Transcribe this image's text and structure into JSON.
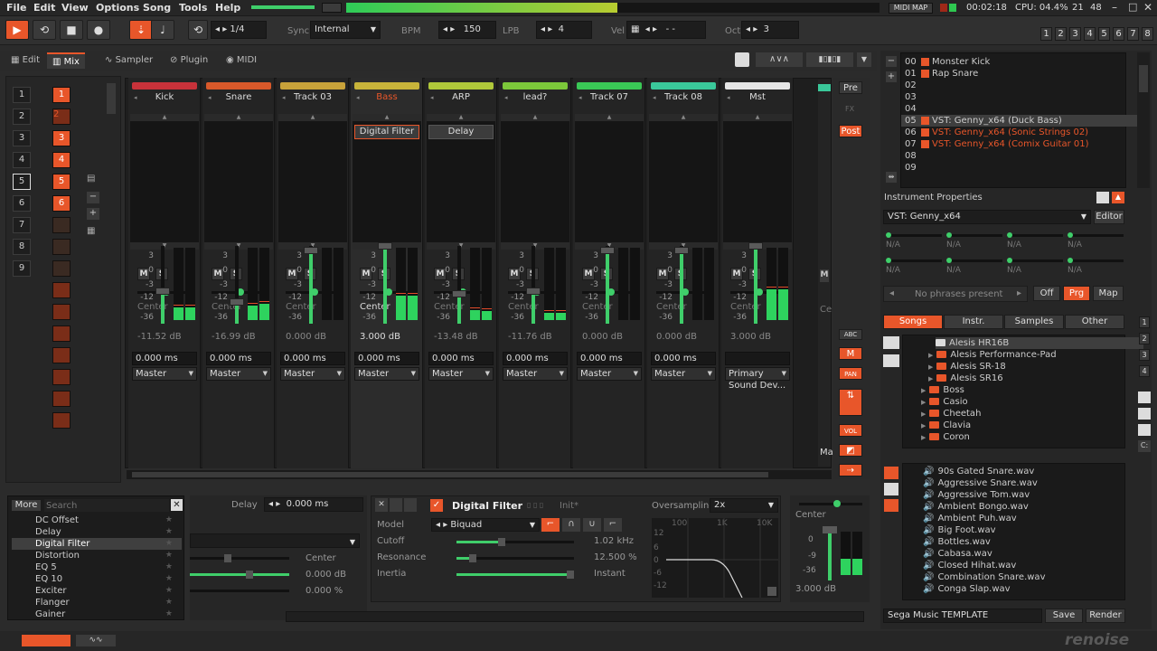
{
  "menu": [
    "File",
    "Edit",
    "View",
    "Options",
    "Song",
    "Tools",
    "Help"
  ],
  "topbar": {
    "midi_map": "MIDI MAP",
    "time": "00:02:18",
    "cpu": "CPU: 04.4%",
    "n1": "21",
    "n2": "48"
  },
  "toolbar": {
    "pattern_step": "1/4",
    "sync_label": "Sync",
    "sync_value": "Internal",
    "bpm_label": "BPM",
    "bpm_value": "150",
    "lpb_label": "LPB",
    "lpb_value": "4",
    "vel_label": "Vel",
    "vel_value": "- -",
    "oct_label": "Oct",
    "oct_value": "3",
    "track_nums": [
      "1",
      "2",
      "3",
      "4",
      "5",
      "6",
      "7",
      "8"
    ]
  },
  "tabs": [
    {
      "label": "Edit"
    },
    {
      "label": "Mix"
    },
    {
      "label": "Sampler"
    },
    {
      "label": "Plugin"
    },
    {
      "label": "MIDI"
    }
  ],
  "sequencer": {
    "rows": [
      "1",
      "2",
      "3",
      "4",
      "5",
      "6",
      "7",
      "8",
      "9"
    ],
    "slots": [
      "1",
      "2",
      "3",
      "4",
      "5",
      "6"
    ]
  },
  "tracks": [
    {
      "name": "Kick",
      "color": "#c8323a",
      "db": "-11.52 dB",
      "fx": [],
      "delay": "0.000 ms",
      "route": "Master",
      "center": "Center"
    },
    {
      "name": "Snare",
      "color": "#d9592a",
      "db": "-16.99 dB",
      "fx": [],
      "delay": "0.000 ms",
      "route": "Master",
      "center": "Center"
    },
    {
      "name": "Track 03",
      "color": "#c8a23a",
      "db": "0.000 dB",
      "fx": [],
      "delay": "0.000 ms",
      "route": "Master",
      "center": "Center"
    },
    {
      "name": "Bass",
      "color": "#c8b43a",
      "db": "3.000 dB",
      "fx": [
        "Digital Filter"
      ],
      "delay": "0.000 ms",
      "route": "Master",
      "center": "Center"
    },
    {
      "name": "ARP",
      "color": "#b0c83a",
      "db": "-13.48 dB",
      "fx": [
        "Delay"
      ],
      "delay": "0.000 ms",
      "route": "Master",
      "center": "Center"
    },
    {
      "name": "lead?",
      "color": "#7cc83a",
      "db": "-11.76 dB",
      "fx": [],
      "delay": "0.000 ms",
      "route": "Master",
      "center": "Center"
    },
    {
      "name": "Track 07",
      "color": "#3ac856",
      "db": "0.000 dB",
      "fx": [],
      "delay": "0.000 ms",
      "route": "Master",
      "center": "Center"
    },
    {
      "name": "Track 08",
      "color": "#3ac89a",
      "db": "0.000 dB",
      "fx": [],
      "delay": "0.000 ms",
      "route": "Master",
      "center": "Center"
    },
    {
      "name": "Mst",
      "color": "#e6e6e6",
      "db": "3.000 dB",
      "fx": [],
      "delay": "",
      "route": "Primary Sound Dev...",
      "center": "Center"
    }
  ],
  "db_scale": [
    "3",
    "0",
    "-3",
    "-12",
    "-36"
  ],
  "right_strip": {
    "pre": "Pre",
    "fx": "FX",
    "post": "Post",
    "abc": "ABC",
    "m": "M",
    "pan": "PAN",
    "vol": "VOL"
  },
  "instruments": [
    {
      "num": "00",
      "name": "Monster Kick",
      "plugin": false
    },
    {
      "num": "01",
      "name": "Rap Snare",
      "plugin": false
    },
    {
      "num": "02",
      "name": "",
      "plugin": false
    },
    {
      "num": "03",
      "name": "",
      "plugin": false
    },
    {
      "num": "04",
      "name": "",
      "plugin": false
    },
    {
      "num": "05",
      "name": "VST: Genny_x64 (Duck Bass)",
      "plugin": true
    },
    {
      "num": "06",
      "name": "VST: Genny_x64 (Sonic Strings 02)",
      "plugin": true
    },
    {
      "num": "07",
      "name": "VST: Genny_x64 (Comix Guitar 01)",
      "plugin": true
    },
    {
      "num": "08",
      "name": "",
      "plugin": false
    },
    {
      "num": "09",
      "name": "",
      "plugin": false
    }
  ],
  "inst_props": {
    "title": "Instrument Properties",
    "plugin": "VST: Genny_x64",
    "editor": "Editor",
    "na": "N/A",
    "phrases": "No phrases present",
    "off": "Off",
    "prg": "Prg",
    "map": "Map"
  },
  "browser": {
    "tabs": [
      "Songs",
      "Instr.",
      "Samples",
      "Other"
    ],
    "tree": [
      {
        "name": "Alesis HR16B",
        "indent": 0,
        "selected": true
      },
      {
        "name": "Alesis Performance-Pad",
        "indent": 1,
        "selected": false
      },
      {
        "name": "Alesis SR-18",
        "indent": 1,
        "selected": false
      },
      {
        "name": "Alesis SR16",
        "indent": 1,
        "selected": false
      },
      {
        "name": "Boss",
        "indent": 0,
        "selected": false
      },
      {
        "name": "Casio",
        "indent": 0,
        "selected": false
      },
      {
        "name": "Cheetah",
        "indent": 0,
        "selected": false
      },
      {
        "name": "Clavia",
        "indent": 0,
        "selected": false
      },
      {
        "name": "Coron",
        "indent": 0,
        "selected": false
      }
    ],
    "files": [
      "90s Gated Snare.wav",
      "Aggressive Snare.wav",
      "Aggressive Tom.wav",
      "Ambient Bongo.wav",
      "Ambient Puh.wav",
      "Big Foot.wav",
      "Bottles.wav",
      "Cabasa.wav",
      "Closed Hihat.wav",
      "Combination Snare.wav",
      "Conga Slap.wav"
    ],
    "template": "Sega Music TEMPLATE",
    "save": "Save",
    "render": "Render"
  },
  "fx_list": {
    "more": "More",
    "search_placeholder": "Search",
    "items": [
      "DC Offset",
      "Delay",
      "Digital Filter",
      "Distortion",
      "EQ 5",
      "EQ 10",
      "Exciter",
      "Flanger",
      "Gainer"
    ],
    "selected": "Digital Filter"
  },
  "track_dsp": {
    "delay_label": "Delay",
    "delay_value": "0.000 ms",
    "center": "Center",
    "gain": "0.000 dB",
    "width": "0.000 %"
  },
  "device": {
    "name": "Digital Filter",
    "preset": "Init*",
    "oversampling_label": "Oversampling",
    "oversampling_value": "2x",
    "model_label": "Model",
    "model_value": "Biquad",
    "cutoff_label": "Cutoff",
    "cutoff_value": "1.02 kHz",
    "resonance_label": "Resonance",
    "resonance_value": "12.500 %",
    "inertia_label": "Inertia",
    "inertia_value": "Instant",
    "graph_x": [
      "100",
      "1K",
      "10K"
    ],
    "graph_y": [
      "12",
      "6",
      "0",
      "-6",
      "-12"
    ]
  },
  "master_mini": {
    "center": "Center",
    "db": "3.000 dB",
    "scale": [
      "0",
      "-9",
      "-36"
    ]
  },
  "logo": "renoise"
}
